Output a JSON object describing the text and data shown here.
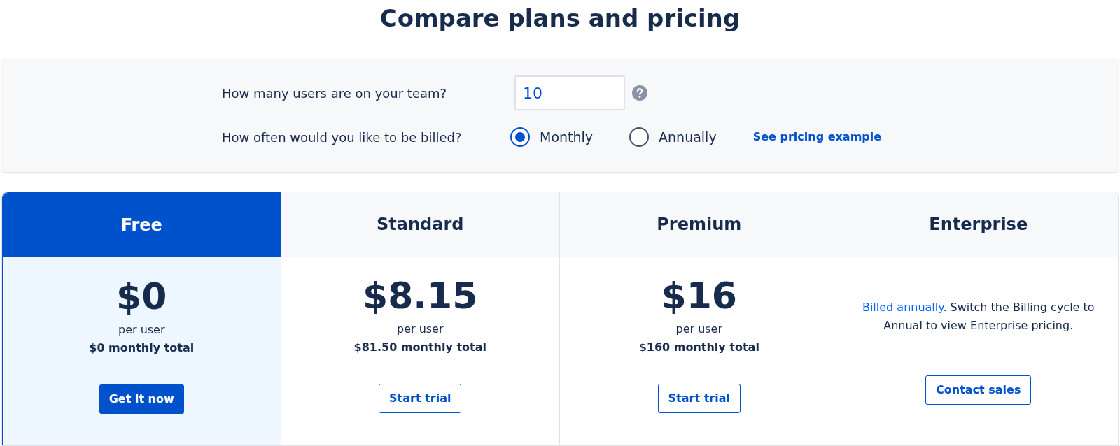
{
  "title": "Compare plans and pricing",
  "users": {
    "label": "How many users are on your team?",
    "value": "10"
  },
  "billing": {
    "label": "How often would you like to be billed?",
    "options": [
      {
        "label": "Monthly",
        "selected": true
      },
      {
        "label": "Annually",
        "selected": false
      }
    ],
    "link": "See pricing example"
  },
  "plans": [
    {
      "kind": "price",
      "name": "Free",
      "selected": true,
      "price": "$0",
      "per": "per user",
      "total": "$0 monthly total",
      "button": "Get it now"
    },
    {
      "kind": "price",
      "name": "Standard",
      "selected": false,
      "price": "$8.15",
      "per": "per user",
      "total": "$81.50 monthly total",
      "button": "Start trial"
    },
    {
      "kind": "price",
      "name": "Premium",
      "selected": false,
      "price": "$16",
      "per": "per user",
      "total": "$160 monthly total",
      "button": "Start trial"
    },
    {
      "kind": "note",
      "name": "Enterprise",
      "selected": false,
      "note_link": "Billed annually",
      "note": ". Switch the Billing cycle to Annual to view Enterprise pricing.",
      "button": "Contact sales"
    }
  ]
}
